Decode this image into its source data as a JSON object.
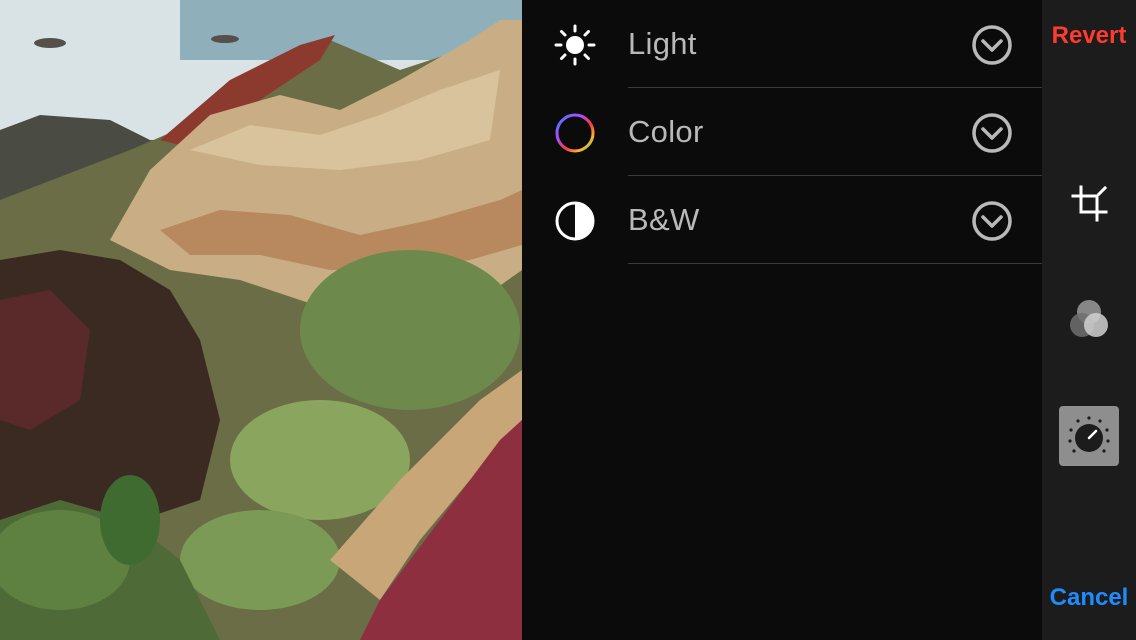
{
  "panel": {
    "items": [
      {
        "label": "Light",
        "icon": "sun-icon"
      },
      {
        "label": "Color",
        "icon": "color-wheel-icon"
      },
      {
        "label": "B&W",
        "icon": "half-circle-icon"
      }
    ]
  },
  "toolbar": {
    "revert_label": "Revert",
    "cancel_label": "Cancel",
    "tools": [
      {
        "icon": "crop-icon"
      },
      {
        "icon": "filters-icon"
      },
      {
        "icon": "adjust-dial-icon",
        "active": true
      }
    ]
  },
  "colors": {
    "revert": "#ff3b30",
    "cancel": "#1d8cff",
    "label": "#b9b9b9"
  }
}
